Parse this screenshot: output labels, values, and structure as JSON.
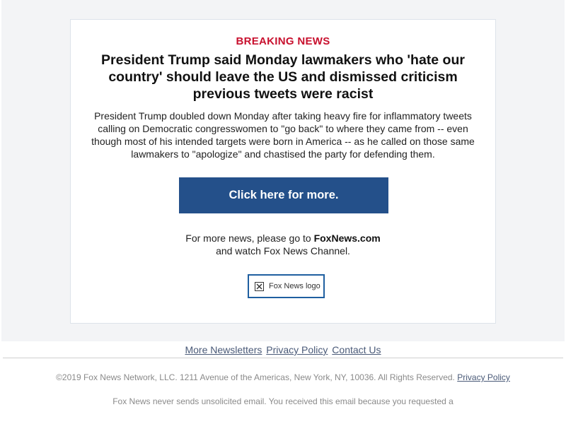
{
  "email": {
    "kicker": "BREAKING NEWS",
    "headline": "President Trump said Monday lawmakers who 'hate our country' should leave the US and dismissed criticism previous tweets were racist",
    "summary": "President Trump doubled down Monday after taking heavy fire for inflammatory tweets calling on Democratic congresswomen to \"go back\" to where they came from -- even though most of his intended targets were born in America -- as he called on those same lawmakers to \"apologize\" and chastised the party for defending them.",
    "cta_label": "Click here for more.",
    "more_news_prefix": "For more news, please go to ",
    "more_news_site": "FoxNews.com",
    "more_news_suffix": "and watch Fox News Channel.",
    "logo_alt": "Fox News logo",
    "broken_image_icon": "broken-image-icon"
  },
  "footer": {
    "links": [
      "More Newsletters",
      "Privacy Policy",
      "Contact Us"
    ],
    "copyright": "©2019 Fox News Network, LLC. 1211 Avenue of the Americas, New York, NY, 10036. All Rights Reserved.",
    "copyright_link": "Privacy Policy",
    "disclaimer": "Fox News never sends unsolicited email. You received this email because you requested a"
  },
  "colors": {
    "kicker": "#c8102e",
    "cta_background": "#24508a",
    "page_background": "#f3f4f6",
    "link": "#4a5a78"
  }
}
